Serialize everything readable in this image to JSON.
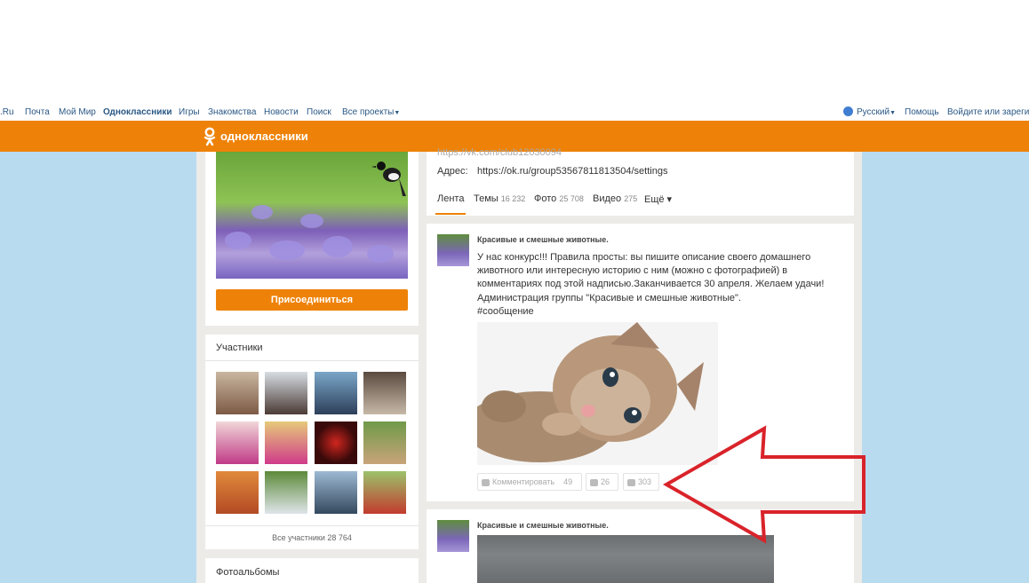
{
  "portal": {
    "links": [
      ".Ru",
      "Почта",
      "Мой Мир",
      "Одноклассники",
      "Игры",
      "Знакомства",
      "Новости",
      "Поиск",
      "Все проекты"
    ],
    "language": "Русский",
    "help": "Помощь",
    "login": "Войдите или зарегистрируйтесь"
  },
  "brand": {
    "name": "одноклассники",
    "color": "#ee8208"
  },
  "group": {
    "join_label": "Присоединиться",
    "members_title": "Участники",
    "all_members": "Все участники 28 764",
    "albums_title": "Фотоальбомы",
    "faded_url": "https://vk.com/club12030094",
    "address_label": "Адрес:",
    "address_value": "https://ok.ru/group53567811813504/settings",
    "tabs": [
      {
        "label": "Лента",
        "count": ""
      },
      {
        "label": "Темы",
        "count": "16 232"
      },
      {
        "label": "Фото",
        "count": "25 708"
      },
      {
        "label": "Видео",
        "count": "275"
      },
      {
        "label": "Ещё ▾",
        "count": ""
      }
    ]
  },
  "post1": {
    "group_name": "Красивые и смешные животные.",
    "lines": [
      "У нас конкурс!!! Правила просты: вы пишите описание своего домашнего",
      "животного или интересную историю с ним (можно с фотографией) в",
      "комментариях под этой надписью.Заканчивается 30 апреля. Желаем удачи!",
      "Администрация группы \"Красивые и смешные животные\".",
      "#сообщение"
    ],
    "comment_label": "Комментировать",
    "comment_count": "49",
    "share_count": "26",
    "like_count": "303"
  },
  "post2": {
    "group_name": "Красивые и смешные животные."
  },
  "annotation": {
    "arrow_color": "#d9232a"
  }
}
